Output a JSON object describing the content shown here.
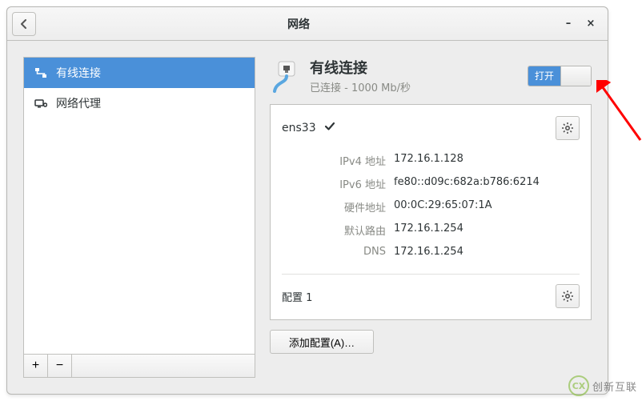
{
  "window": {
    "title": "网络"
  },
  "sidebar": {
    "items": [
      {
        "label": "有线连接",
        "icon": "wired"
      },
      {
        "label": "网络代理",
        "icon": "proxy"
      }
    ]
  },
  "panel": {
    "title": "有线连接",
    "subtitle": "已连接 - 1000 Mb/秒",
    "switch_on_label": "打开",
    "interface_name": "ens33",
    "rows": [
      {
        "label": "IPv4 地址",
        "value": "172.16.1.128"
      },
      {
        "label": "IPv6 地址",
        "value": "fe80::d09c:682a:b786:6214"
      },
      {
        "label": "硬件地址",
        "value": "00:0C:29:65:07:1A"
      },
      {
        "label": "默认路由",
        "value": "172.16.1.254"
      },
      {
        "label": "DNS",
        "value": "172.16.1.254"
      }
    ],
    "profile_label": "配置 1",
    "add_profile_label": "添加配置(A)…"
  },
  "watermark": {
    "text": "创新互联"
  }
}
